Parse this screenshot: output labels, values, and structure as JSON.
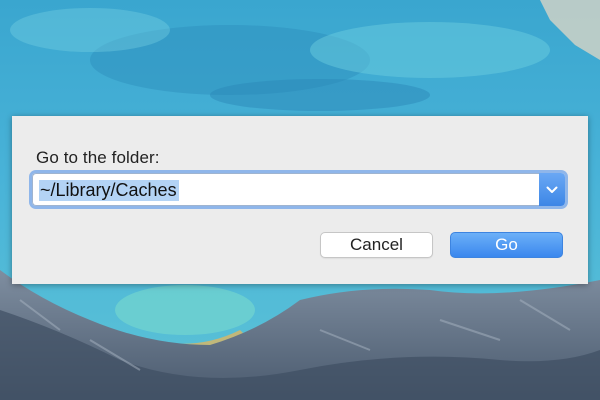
{
  "dialog": {
    "prompt": "Go to the folder:",
    "path_value": "~/Library/Caches",
    "path_selected": true,
    "cancel_label": "Cancel",
    "go_label": "Go",
    "icons": {
      "dropdown": "chevron-down-icon"
    }
  },
  "colors": {
    "dialog_bg": "#ececec",
    "focus_ring": "#8fb6ea",
    "selection": "#b3d3f5",
    "accent": "#3d86e6"
  }
}
